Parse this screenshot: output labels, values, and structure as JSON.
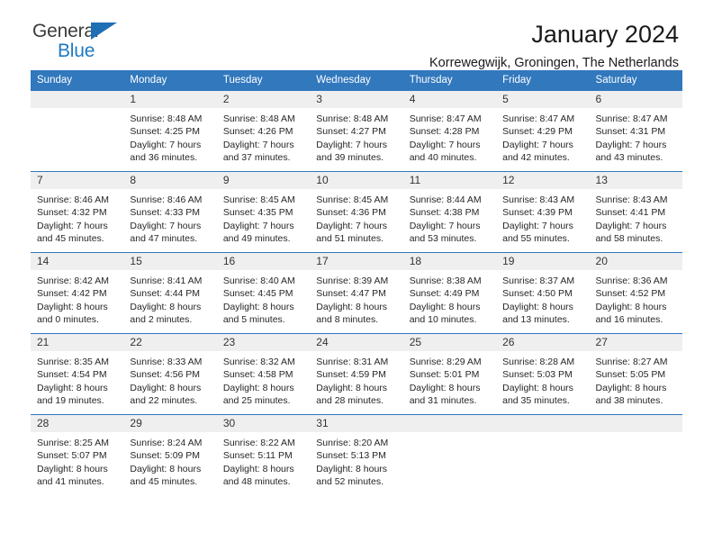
{
  "brand": {
    "name_top": "General",
    "name_bottom": "Blue",
    "triangle_icon": "triangle-icon",
    "accent_color": "#1f7ac2"
  },
  "header": {
    "title": "January 2024",
    "subtitle": "Korrewegwijk, Groningen, The Netherlands"
  },
  "calendar": {
    "header_bg": "#3178bd",
    "daynum_bg": "#efefef",
    "weekday_headers": [
      "Sunday",
      "Monday",
      "Tuesday",
      "Wednesday",
      "Thursday",
      "Friday",
      "Saturday"
    ],
    "weeks": [
      [
        {
          "day": "",
          "empty": true,
          "sunrise": "",
          "sunset": "",
          "daylight_1": "",
          "daylight_2": ""
        },
        {
          "day": "1",
          "sunrise": "Sunrise: 8:48 AM",
          "sunset": "Sunset: 4:25 PM",
          "daylight_1": "Daylight: 7 hours",
          "daylight_2": "and 36 minutes."
        },
        {
          "day": "2",
          "sunrise": "Sunrise: 8:48 AM",
          "sunset": "Sunset: 4:26 PM",
          "daylight_1": "Daylight: 7 hours",
          "daylight_2": "and 37 minutes."
        },
        {
          "day": "3",
          "sunrise": "Sunrise: 8:48 AM",
          "sunset": "Sunset: 4:27 PM",
          "daylight_1": "Daylight: 7 hours",
          "daylight_2": "and 39 minutes."
        },
        {
          "day": "4",
          "sunrise": "Sunrise: 8:47 AM",
          "sunset": "Sunset: 4:28 PM",
          "daylight_1": "Daylight: 7 hours",
          "daylight_2": "and 40 minutes."
        },
        {
          "day": "5",
          "sunrise": "Sunrise: 8:47 AM",
          "sunset": "Sunset: 4:29 PM",
          "daylight_1": "Daylight: 7 hours",
          "daylight_2": "and 42 minutes."
        },
        {
          "day": "6",
          "sunrise": "Sunrise: 8:47 AM",
          "sunset": "Sunset: 4:31 PM",
          "daylight_1": "Daylight: 7 hours",
          "daylight_2": "and 43 minutes."
        }
      ],
      [
        {
          "day": "7",
          "sunrise": "Sunrise: 8:46 AM",
          "sunset": "Sunset: 4:32 PM",
          "daylight_1": "Daylight: 7 hours",
          "daylight_2": "and 45 minutes."
        },
        {
          "day": "8",
          "sunrise": "Sunrise: 8:46 AM",
          "sunset": "Sunset: 4:33 PM",
          "daylight_1": "Daylight: 7 hours",
          "daylight_2": "and 47 minutes."
        },
        {
          "day": "9",
          "sunrise": "Sunrise: 8:45 AM",
          "sunset": "Sunset: 4:35 PM",
          "daylight_1": "Daylight: 7 hours",
          "daylight_2": "and 49 minutes."
        },
        {
          "day": "10",
          "sunrise": "Sunrise: 8:45 AM",
          "sunset": "Sunset: 4:36 PM",
          "daylight_1": "Daylight: 7 hours",
          "daylight_2": "and 51 minutes."
        },
        {
          "day": "11",
          "sunrise": "Sunrise: 8:44 AM",
          "sunset": "Sunset: 4:38 PM",
          "daylight_1": "Daylight: 7 hours",
          "daylight_2": "and 53 minutes."
        },
        {
          "day": "12",
          "sunrise": "Sunrise: 8:43 AM",
          "sunset": "Sunset: 4:39 PM",
          "daylight_1": "Daylight: 7 hours",
          "daylight_2": "and 55 minutes."
        },
        {
          "day": "13",
          "sunrise": "Sunrise: 8:43 AM",
          "sunset": "Sunset: 4:41 PM",
          "daylight_1": "Daylight: 7 hours",
          "daylight_2": "and 58 minutes."
        }
      ],
      [
        {
          "day": "14",
          "sunrise": "Sunrise: 8:42 AM",
          "sunset": "Sunset: 4:42 PM",
          "daylight_1": "Daylight: 8 hours",
          "daylight_2": "and 0 minutes."
        },
        {
          "day": "15",
          "sunrise": "Sunrise: 8:41 AM",
          "sunset": "Sunset: 4:44 PM",
          "daylight_1": "Daylight: 8 hours",
          "daylight_2": "and 2 minutes."
        },
        {
          "day": "16",
          "sunrise": "Sunrise: 8:40 AM",
          "sunset": "Sunset: 4:45 PM",
          "daylight_1": "Daylight: 8 hours",
          "daylight_2": "and 5 minutes."
        },
        {
          "day": "17",
          "sunrise": "Sunrise: 8:39 AM",
          "sunset": "Sunset: 4:47 PM",
          "daylight_1": "Daylight: 8 hours",
          "daylight_2": "and 8 minutes."
        },
        {
          "day": "18",
          "sunrise": "Sunrise: 8:38 AM",
          "sunset": "Sunset: 4:49 PM",
          "daylight_1": "Daylight: 8 hours",
          "daylight_2": "and 10 minutes."
        },
        {
          "day": "19",
          "sunrise": "Sunrise: 8:37 AM",
          "sunset": "Sunset: 4:50 PM",
          "daylight_1": "Daylight: 8 hours",
          "daylight_2": "and 13 minutes."
        },
        {
          "day": "20",
          "sunrise": "Sunrise: 8:36 AM",
          "sunset": "Sunset: 4:52 PM",
          "daylight_1": "Daylight: 8 hours",
          "daylight_2": "and 16 minutes."
        }
      ],
      [
        {
          "day": "21",
          "sunrise": "Sunrise: 8:35 AM",
          "sunset": "Sunset: 4:54 PM",
          "daylight_1": "Daylight: 8 hours",
          "daylight_2": "and 19 minutes."
        },
        {
          "day": "22",
          "sunrise": "Sunrise: 8:33 AM",
          "sunset": "Sunset: 4:56 PM",
          "daylight_1": "Daylight: 8 hours",
          "daylight_2": "and 22 minutes."
        },
        {
          "day": "23",
          "sunrise": "Sunrise: 8:32 AM",
          "sunset": "Sunset: 4:58 PM",
          "daylight_1": "Daylight: 8 hours",
          "daylight_2": "and 25 minutes."
        },
        {
          "day": "24",
          "sunrise": "Sunrise: 8:31 AM",
          "sunset": "Sunset: 4:59 PM",
          "daylight_1": "Daylight: 8 hours",
          "daylight_2": "and 28 minutes."
        },
        {
          "day": "25",
          "sunrise": "Sunrise: 8:29 AM",
          "sunset": "Sunset: 5:01 PM",
          "daylight_1": "Daylight: 8 hours",
          "daylight_2": "and 31 minutes."
        },
        {
          "day": "26",
          "sunrise": "Sunrise: 8:28 AM",
          "sunset": "Sunset: 5:03 PM",
          "daylight_1": "Daylight: 8 hours",
          "daylight_2": "and 35 minutes."
        },
        {
          "day": "27",
          "sunrise": "Sunrise: 8:27 AM",
          "sunset": "Sunset: 5:05 PM",
          "daylight_1": "Daylight: 8 hours",
          "daylight_2": "and 38 minutes."
        }
      ],
      [
        {
          "day": "28",
          "sunrise": "Sunrise: 8:25 AM",
          "sunset": "Sunset: 5:07 PM",
          "daylight_1": "Daylight: 8 hours",
          "daylight_2": "and 41 minutes."
        },
        {
          "day": "29",
          "sunrise": "Sunrise: 8:24 AM",
          "sunset": "Sunset: 5:09 PM",
          "daylight_1": "Daylight: 8 hours",
          "daylight_2": "and 45 minutes."
        },
        {
          "day": "30",
          "sunrise": "Sunrise: 8:22 AM",
          "sunset": "Sunset: 5:11 PM",
          "daylight_1": "Daylight: 8 hours",
          "daylight_2": "and 48 minutes."
        },
        {
          "day": "31",
          "sunrise": "Sunrise: 8:20 AM",
          "sunset": "Sunset: 5:13 PM",
          "daylight_1": "Daylight: 8 hours",
          "daylight_2": "and 52 minutes."
        },
        {
          "day": "",
          "empty": true,
          "sunrise": "",
          "sunset": "",
          "daylight_1": "",
          "daylight_2": ""
        },
        {
          "day": "",
          "empty": true,
          "sunrise": "",
          "sunset": "",
          "daylight_1": "",
          "daylight_2": ""
        },
        {
          "day": "",
          "empty": true,
          "sunrise": "",
          "sunset": "",
          "daylight_1": "",
          "daylight_2": ""
        }
      ]
    ]
  }
}
